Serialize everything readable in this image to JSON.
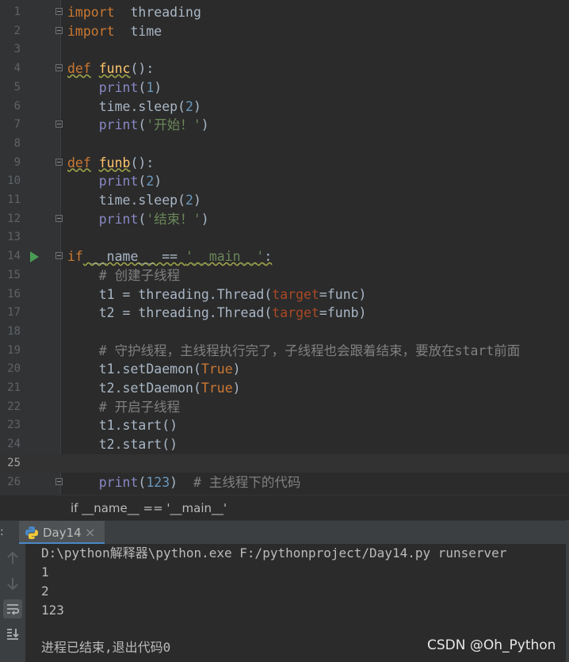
{
  "editor": {
    "current_line": 25,
    "lines": [
      {
        "n": "1",
        "tokens": [
          [
            "kw",
            "import"
          ],
          [
            "",
            "  threading"
          ]
        ]
      },
      {
        "n": "2",
        "tokens": [
          [
            "kw",
            "import"
          ],
          [
            "",
            "  time"
          ]
        ]
      },
      {
        "n": "3",
        "tokens": []
      },
      {
        "n": "4",
        "tokens": [
          [
            "kw",
            "def"
          ],
          [
            "",
            " "
          ],
          [
            "fn",
            "func"
          ],
          [
            "",
            "():"
          ]
        ]
      },
      {
        "n": "5",
        "tokens": [
          [
            "",
            "    "
          ],
          [
            "bi",
            "print"
          ],
          [
            "",
            "("
          ],
          [
            "num",
            "1"
          ],
          [
            "",
            ")"
          ]
        ]
      },
      {
        "n": "6",
        "tokens": [
          [
            "",
            "    time.sleep("
          ],
          [
            "num",
            "2"
          ],
          [
            "",
            ")"
          ]
        ]
      },
      {
        "n": "7",
        "tokens": [
          [
            "",
            "    "
          ],
          [
            "bi",
            "print"
          ],
          [
            "",
            "("
          ],
          [
            "str",
            "'开始！'"
          ],
          [
            "",
            ")"
          ]
        ]
      },
      {
        "n": "8",
        "tokens": []
      },
      {
        "n": "9",
        "tokens": [
          [
            "kw",
            "def"
          ],
          [
            "",
            " "
          ],
          [
            "fn",
            "funb"
          ],
          [
            "",
            "():"
          ]
        ]
      },
      {
        "n": "10",
        "tokens": [
          [
            "",
            "    "
          ],
          [
            "bi",
            "print"
          ],
          [
            "",
            "("
          ],
          [
            "num",
            "2"
          ],
          [
            "",
            ")"
          ]
        ]
      },
      {
        "n": "11",
        "tokens": [
          [
            "",
            "    time.sleep("
          ],
          [
            "num",
            "2"
          ],
          [
            "",
            ")"
          ]
        ]
      },
      {
        "n": "12",
        "tokens": [
          [
            "",
            "    "
          ],
          [
            "bi",
            "print"
          ],
          [
            "",
            "("
          ],
          [
            "str",
            "'结束！'"
          ],
          [
            "",
            ")"
          ]
        ]
      },
      {
        "n": "13",
        "tokens": []
      },
      {
        "n": "14",
        "tokens": [
          [
            "kw",
            "if"
          ],
          [
            "",
            " __name__ == "
          ],
          [
            "str",
            "'__main__'"
          ],
          [
            "",
            ":"
          ]
        ]
      },
      {
        "n": "15",
        "tokens": [
          [
            "",
            "    "
          ],
          [
            "cm",
            "# 创建子线程"
          ]
        ]
      },
      {
        "n": "16",
        "tokens": [
          [
            "",
            "    t1 = threading.Thread("
          ],
          [
            "prm",
            "target"
          ],
          [
            "",
            "=func)"
          ]
        ]
      },
      {
        "n": "17",
        "tokens": [
          [
            "",
            "    t2 = threading.Thread("
          ],
          [
            "prm",
            "target"
          ],
          [
            "",
            "=funb)"
          ]
        ]
      },
      {
        "n": "18",
        "tokens": []
      },
      {
        "n": "19",
        "tokens": [
          [
            "",
            "    "
          ],
          [
            "cm",
            "# 守护线程，主线程执行完了，子线程也会跟着结束，要放在start前面"
          ]
        ]
      },
      {
        "n": "20",
        "tokens": [
          [
            "",
            "    t1.setDaemon("
          ],
          [
            "tr",
            "True"
          ],
          [
            "",
            ")"
          ]
        ]
      },
      {
        "n": "21",
        "tokens": [
          [
            "",
            "    t2.setDaemon("
          ],
          [
            "tr",
            "True"
          ],
          [
            "",
            ")"
          ]
        ]
      },
      {
        "n": "22",
        "tokens": [
          [
            "",
            "    "
          ],
          [
            "cm",
            "# 开启子线程"
          ]
        ]
      },
      {
        "n": "23",
        "tokens": [
          [
            "",
            "    t1.start()"
          ]
        ]
      },
      {
        "n": "24",
        "tokens": [
          [
            "",
            "    t2.start()"
          ]
        ]
      },
      {
        "n": "25",
        "tokens": []
      },
      {
        "n": "26",
        "tokens": [
          [
            "",
            "    "
          ],
          [
            "bi",
            "print"
          ],
          [
            "",
            "("
          ],
          [
            "num",
            "123"
          ],
          [
            "",
            ")  "
          ],
          [
            "cm",
            "# 主线程下的代码"
          ]
        ]
      }
    ]
  },
  "breadcrumb": "if __name__ == '__main__'",
  "run_panel": {
    "label": ":",
    "tab_title": "Day14",
    "tab_close": "×"
  },
  "console": {
    "lines": [
      "D:\\python解释器\\python.exe F:/pythonproject/Day14.py runserver",
      "1",
      "2",
      "123",
      "",
      "进程已结束,退出代码0"
    ]
  },
  "watermark": "CSDN @Oh_Python",
  "colors": {
    "background": "#2b2b2b",
    "keyword": "#cc7832",
    "function": "#ffc66d",
    "number": "#6897bb",
    "string": "#6a8759",
    "comment": "#808080"
  }
}
